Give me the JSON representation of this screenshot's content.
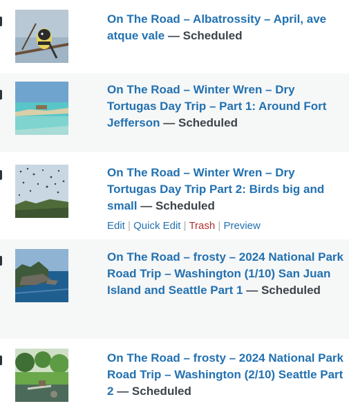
{
  "separator": " — ",
  "rows": [
    {
      "title": "On The Road – Albatrossity – April, ave atque vale",
      "state": "Scheduled",
      "thumb": "bird-on-branch-photo"
    },
    {
      "title": "On The Road – Winter Wren – Dry Tortugas Day Trip – Part 1: Around Fort Jefferson",
      "state": "Scheduled",
      "thumb": "tropical-beach-photo"
    },
    {
      "title": "On The Road – Winter Wren – Dry Tortugas Day Trip Part 2: Birds big and small",
      "state": "Scheduled",
      "thumb": "birds-flock-sky-photo",
      "actions": {
        "edit": "Edit",
        "quick_edit": "Quick Edit",
        "trash": "Trash",
        "preview": "Preview",
        "divider": "|"
      }
    },
    {
      "title": "On The Road – frosty – 2024 National Park Road Trip – Washington (1/10) San Juan Island and Seattle Part 1",
      "state": "Scheduled",
      "thumb": "rocky-coast-photo"
    },
    {
      "title": "On The Road – frosty – 2024 National Park Road Trip – Washington (2/10) Seattle Part 2",
      "state": "Scheduled",
      "thumb": "japanese-garden-photo"
    }
  ]
}
